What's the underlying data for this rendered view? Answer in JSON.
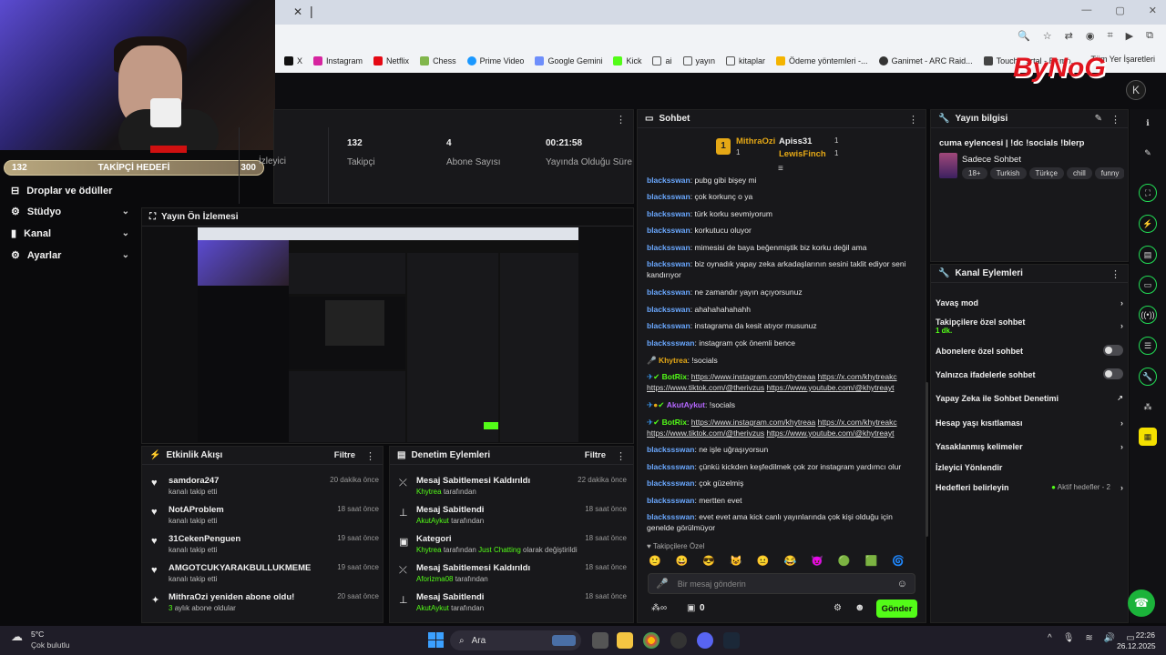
{
  "browser": {
    "bookmarks": [
      "X",
      "Instagram",
      "Netflix",
      "Chess",
      "Prime Video",
      "Google Gemini",
      "Kick",
      "ai",
      "yayın",
      "kitaplar",
      "Ödeme yöntemleri -...",
      "Ganimet - ARC Raid...",
      "Touch Portal - Remo..."
    ],
    "bookmarks_right": "Tüm Yer İşaretleri"
  },
  "overlay": {
    "brand": "ByNoG"
  },
  "goal": {
    "current": "132",
    "label": "TAKİPÇİ HEDEFİ",
    "target": "300",
    "progress": 0.44
  },
  "nav": {
    "items": [
      {
        "label": "Droplar ve ödüller"
      },
      {
        "label": "Stüdyo"
      },
      {
        "label": "Kanal"
      },
      {
        "label": "Ayarlar"
      }
    ]
  },
  "stats": {
    "partial_label": "İzleyici",
    "followers_value": "132",
    "followers_label": "Takipçi",
    "subs_value": "4",
    "subs_label": "Abone Sayısı",
    "uptime_value": "00:21:58",
    "uptime_label": "Yayında Olduğu Süre"
  },
  "preview": {
    "title": "Yayın Ön İzlemesi"
  },
  "activity": {
    "title": "Etkinlik Akışı",
    "filter": "Filtre",
    "items": [
      {
        "name": "samdora247",
        "sub": "kanalı takip etti",
        "time": "20 dakika önce"
      },
      {
        "name": "NotAProblem",
        "sub": "kanalı takip etti",
        "time": "18 saat önce"
      },
      {
        "name": "31CekenPenguen",
        "sub": "kanalı takip etti",
        "time": "19 saat önce"
      },
      {
        "name": "AMGOTCUKYARAKBULLUKMEME",
        "sub": "kanalı takip etti",
        "time": "19 saat önce"
      },
      {
        "name": "MithraOzi yeniden abone oldu!",
        "sub_pre": "3",
        "sub": "aylık abone oldular",
        "time": "20 saat önce"
      }
    ]
  },
  "mod": {
    "title": "Denetim Eylemleri",
    "filter": "Filtre",
    "items": [
      {
        "title": "Mesaj Sabitlemesi Kaldırıldı",
        "user": "Khytrea",
        "sub": "tarafından",
        "time": "22 dakika önce"
      },
      {
        "title": "Mesaj Sabitlendi",
        "user": "AkutAykut",
        "sub": "tarafından",
        "time": "18 saat önce"
      },
      {
        "title": "Kategori",
        "user": "Khytrea",
        "sub": "tarafından",
        "category": "Just Chatting",
        "sub2": "olarak değiştirildi",
        "time": "18 saat önce"
      },
      {
        "title": "Mesaj Sabitlemesi Kaldırıldı",
        "user": "Aforizma08",
        "sub": "tarafından",
        "time": "18 saat önce"
      },
      {
        "title": "Mesaj Sabitlendi",
        "user": "AkutAykut",
        "sub": "tarafından",
        "time": "18 saat önce"
      }
    ]
  },
  "chat": {
    "title": "Sohbet",
    "leaders": [
      {
        "name": "MithraOzi",
        "count": "1"
      },
      {
        "name": "Apiss31",
        "count": "1"
      },
      {
        "name": "LewisFinch",
        "count": "1"
      }
    ],
    "messages": [
      {
        "u": "blacksswan",
        "m": "pubg gibi bişey mi"
      },
      {
        "u": "blacksswan",
        "m": "çok korkunç o ya"
      },
      {
        "u": "blacksswan",
        "m": "türk korku sevmiyorum"
      },
      {
        "u": "blacksswan",
        "m": "korkutucu oluyor"
      },
      {
        "u": "blacksswan",
        "m": "mimesisi de baya beğenmiştik biz korku değil ama"
      },
      {
        "u": "blacksswan",
        "m": "biz oynadık yapay zeka arkadaşlarının sesini taklit ediyor seni kandırıyor"
      },
      {
        "u": "blacksswan",
        "m": "ne zamandır yayın açıyorsunuz"
      },
      {
        "u": "blacksswan",
        "m": "ahahahahahahh"
      },
      {
        "u": "blacksswan",
        "m": "instagrama da kesit atıyor musunuz"
      },
      {
        "u": "blackssswan",
        "m": "instagram çok önemli bence"
      }
    ],
    "khytrea": {
      "u": "Khytrea",
      "m": "!socials"
    },
    "botrix1": {
      "u": "BotRix",
      "l1": "https://www.instagram.com/khytreaa",
      "l2": "https://x.com/khytreakc",
      "l3": "https://www.tiktok.com/@therivzus",
      "l4": "https://www.youtube.com/@khytreayt"
    },
    "akut": {
      "u": "AkutAykut",
      "m": "!socials"
    },
    "botrix2": {
      "u": "BotRix",
      "l1": "https://www.instagram.com/khytreaa",
      "l2": "https://x.com/khytreakc",
      "l3": "https://www.tiktok.com/@therivzus",
      "l4": "https://www.youtube.com/@khytreayt"
    },
    "after": [
      {
        "u": "blackssswan",
        "m": "ne işle uğraşıyorsun"
      },
      {
        "u": "blackssswan",
        "m": "çünkü kickden keşfedilmek çok zor instagram yardımcı olur"
      },
      {
        "u": "blackssswan",
        "m": "çok güzelmiş"
      },
      {
        "u": "blackssswan",
        "m": "mertten evet"
      },
      {
        "u": "blackssswan",
        "m": "evet evet ama kick canlı yayınlarında çok kişi olduğu için genelde görülmüyor"
      }
    ],
    "emote_section": "Takipçilere Özel",
    "placeholder": "Bir mesaj gönderin",
    "points": "0",
    "send": "Gönder"
  },
  "streaminfo": {
    "title": "Yayın bilgisi",
    "stream_title": "cuma eylencesi | !dc !socials !blerp",
    "category": "Sadece Sohbet",
    "tags": [
      "18+",
      "Turkish",
      "Türkçe",
      "chill",
      "funny"
    ]
  },
  "channel": {
    "title": "Kanal Eylemleri",
    "items": [
      {
        "label": "Yavaş mod"
      },
      {
        "label": "Takipçilere özel sohbet",
        "sub": "1 dk."
      },
      {
        "label": "Abonelere özel sohbet"
      },
      {
        "label": "Yalnızca ifadelerle sohbet"
      },
      {
        "label": "Yapay Zeka ile Sohbet Denetimi"
      },
      {
        "label": "Hesap yaşı kısıtlaması"
      },
      {
        "label": "Yasaklanmış kelimeler"
      },
      {
        "label": "İzleyici Yönlendir"
      },
      {
        "label": "Hedefleri belirleyin",
        "extra": "Aktif hedefler - 2"
      }
    ]
  },
  "taskbar": {
    "temp": "5°C",
    "weather": "Çok bulutlu",
    "search": "Ara",
    "time": "22:26",
    "date": "26.12.2025"
  }
}
